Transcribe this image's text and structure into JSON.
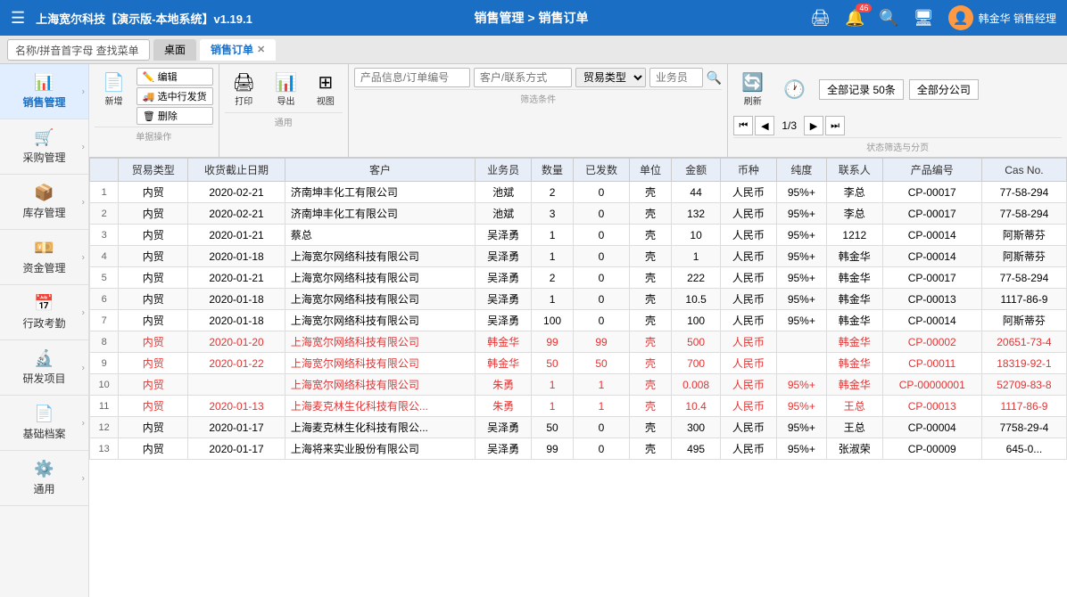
{
  "app": {
    "title": "上海宽尔科技【演示版-本地系统】v1.19.1",
    "nav": "销售管理 > 销售订单",
    "user": "韩金华 销售经理"
  },
  "tabs": {
    "search_placeholder": "名称/拼音首字母 查找菜单",
    "home": "桌面",
    "current": "销售订单"
  },
  "sidebar": {
    "items": [
      {
        "id": "sales",
        "label": "销售管理",
        "icon": "📊",
        "active": true
      },
      {
        "id": "purchase",
        "label": "采购管理",
        "icon": "🛒",
        "active": false
      },
      {
        "id": "inventory",
        "label": "库存管理",
        "icon": "📦",
        "active": false
      },
      {
        "id": "finance",
        "label": "资金管理",
        "icon": "💴",
        "active": false
      },
      {
        "id": "hr",
        "label": "行政考勤",
        "icon": "📅",
        "active": false
      },
      {
        "id": "rd",
        "label": "研发项目",
        "icon": "🔬",
        "active": false
      },
      {
        "id": "archive",
        "label": "基础档案",
        "icon": "📄",
        "active": false
      },
      {
        "id": "general",
        "label": "通用",
        "icon": "⚙️",
        "active": false
      }
    ]
  },
  "toolbar": {
    "new": "新增",
    "edit": "编辑",
    "ship": "选中行发货",
    "delete": "删除",
    "print": "打印",
    "export": "导出",
    "view": "视图",
    "refresh": "刷新",
    "section1": "单据操作",
    "section2": "通用",
    "section3": "筛选条件",
    "section4": "状态筛选与分页"
  },
  "filters": {
    "product_placeholder": "产品信息/订单编号",
    "customer_placeholder": "客户/联系方式",
    "trade_type": "贸易类型",
    "salesperson_placeholder": "业务员",
    "record_count": "全部记录 50条",
    "company_filter": "全部分公司",
    "page_info": "1/3"
  },
  "table": {
    "headers": [
      "",
      "贸易类型",
      "收货截止日期",
      "客户",
      "业务员",
      "数量",
      "已发数",
      "单位",
      "金额",
      "币种",
      "纯度",
      "联系人",
      "产品编号",
      "Cas No."
    ],
    "rows": [
      {
        "num": 1,
        "trade": "内贸",
        "date": "2020-02-21",
        "customer": "济南坤丰化工有限公司",
        "salesperson": "池斌",
        "qty": "2",
        "shipped": "0",
        "unit": "壳",
        "amount": "44",
        "currency": "人民币",
        "purity": "95%+",
        "contact": "李总",
        "product_no": "CP-00017",
        "cas": "77-58-294",
        "red": false
      },
      {
        "num": 2,
        "trade": "内贸",
        "date": "2020-02-21",
        "customer": "济南坤丰化工有限公司",
        "salesperson": "池斌",
        "qty": "3",
        "shipped": "0",
        "unit": "壳",
        "amount": "132",
        "currency": "人民币",
        "purity": "95%+",
        "contact": "李总",
        "product_no": "CP-00017",
        "cas": "77-58-294",
        "red": false
      },
      {
        "num": 3,
        "trade": "内贸",
        "date": "2020-01-21",
        "customer": "蔡总",
        "salesperson": "吴泽勇",
        "qty": "1",
        "shipped": "0",
        "unit": "壳",
        "amount": "10",
        "currency": "人民币",
        "purity": "95%+",
        "contact": "1212",
        "product_no": "CP-00014",
        "cas": "阿斯蒂芬",
        "red": false
      },
      {
        "num": 4,
        "trade": "内贸",
        "date": "2020-01-18",
        "customer": "上海宽尔网络科技有限公司",
        "salesperson": "吴泽勇",
        "qty": "1",
        "shipped": "0",
        "unit": "壳",
        "amount": "1",
        "currency": "人民币",
        "purity": "95%+",
        "contact": "韩金华",
        "product_no": "CP-00014",
        "cas": "阿斯蒂芬",
        "red": false
      },
      {
        "num": 5,
        "trade": "内贸",
        "date": "2020-01-21",
        "customer": "上海宽尔网络科技有限公司",
        "salesperson": "吴泽勇",
        "qty": "2",
        "shipped": "0",
        "unit": "壳",
        "amount": "222",
        "currency": "人民币",
        "purity": "95%+",
        "contact": "韩金华",
        "product_no": "CP-00017",
        "cas": "77-58-294",
        "red": false
      },
      {
        "num": 6,
        "trade": "内贸",
        "date": "2020-01-18",
        "customer": "上海宽尔网络科技有限公司",
        "salesperson": "吴泽勇",
        "qty": "1",
        "shipped": "0",
        "unit": "壳",
        "amount": "10.5",
        "currency": "人民币",
        "purity": "95%+",
        "contact": "韩金华",
        "product_no": "CP-00013",
        "cas": "1117-86-9",
        "red": false
      },
      {
        "num": 7,
        "trade": "内贸",
        "date": "2020-01-18",
        "customer": "上海宽尔网络科技有限公司",
        "salesperson": "吴泽勇",
        "qty": "100",
        "shipped": "0",
        "unit": "壳",
        "amount": "100",
        "currency": "人民币",
        "purity": "95%+",
        "contact": "韩金华",
        "product_no": "CP-00014",
        "cas": "阿斯蒂芬",
        "red": false
      },
      {
        "num": 8,
        "trade": "内贸",
        "date": "2020-01-20",
        "customer": "上海宽尔网络科技有限公司",
        "salesperson": "韩金华",
        "qty": "99",
        "shipped": "99",
        "unit": "壳",
        "amount": "500",
        "currency": "人民币",
        "purity": "",
        "contact": "韩金华",
        "product_no": "CP-00002",
        "cas": "20651-73-4",
        "red": true
      },
      {
        "num": 9,
        "trade": "内贸",
        "date": "2020-01-22",
        "customer": "上海宽尔网络科技有限公司",
        "salesperson": "韩金华",
        "qty": "50",
        "shipped": "50",
        "unit": "壳",
        "amount": "700",
        "currency": "人民币",
        "purity": "",
        "contact": "韩金华",
        "product_no": "CP-00011",
        "cas": "18319-92-1",
        "red": true
      },
      {
        "num": 10,
        "trade": "内贸",
        "date": "",
        "customer": "上海宽尔网络科技有限公司",
        "salesperson": "朱勇",
        "qty": "1",
        "shipped": "1",
        "unit": "壳",
        "amount": "0.008",
        "currency": "人民币",
        "purity": "95%+",
        "contact": "韩金华",
        "product_no": "CP-00000001",
        "cas": "52709-83-8",
        "red": true
      },
      {
        "num": 11,
        "trade": "内贸",
        "date": "2020-01-13",
        "customer": "上海麦克林生化科技有限公...",
        "salesperson": "朱勇",
        "qty": "1",
        "shipped": "1",
        "unit": "壳",
        "amount": "10.4",
        "currency": "人民币",
        "purity": "95%+",
        "contact": "王总",
        "product_no": "CP-00013",
        "cas": "1117-86-9",
        "red": true
      },
      {
        "num": 12,
        "trade": "内贸",
        "date": "2020-01-17",
        "customer": "上海麦克林生化科技有限公...",
        "salesperson": "吴泽勇",
        "qty": "50",
        "shipped": "0",
        "unit": "壳",
        "amount": "300",
        "currency": "人民币",
        "purity": "95%+",
        "contact": "王总",
        "product_no": "CP-00004",
        "cas": "7758-29-4",
        "red": false
      },
      {
        "num": 13,
        "trade": "内贸",
        "date": "2020-01-17",
        "customer": "上海将来实业股份有限公司",
        "salesperson": "吴泽勇",
        "qty": "99",
        "shipped": "0",
        "unit": "壳",
        "amount": "495",
        "currency": "人民币",
        "purity": "95%+",
        "contact": "张淑荣",
        "product_no": "CP-00009",
        "cas": "645-0...",
        "red": false
      }
    ]
  },
  "icons": {
    "hamburger": "☰",
    "bell": "🔔",
    "badge_count": "46",
    "search": "🔍",
    "monitor": "🖥",
    "user_avatar": "👤",
    "new_doc": "📄",
    "edit": "✏️",
    "delete": "🗑",
    "print": "🖨",
    "export": "📤",
    "grid": "⊞",
    "refresh": "🔄",
    "history": "🕐",
    "first": "⏮",
    "prev": "◀",
    "next": "▶",
    "last": "⏭",
    "magnify": "🔍",
    "pencil": "🖊",
    "arrow_right": "›"
  }
}
